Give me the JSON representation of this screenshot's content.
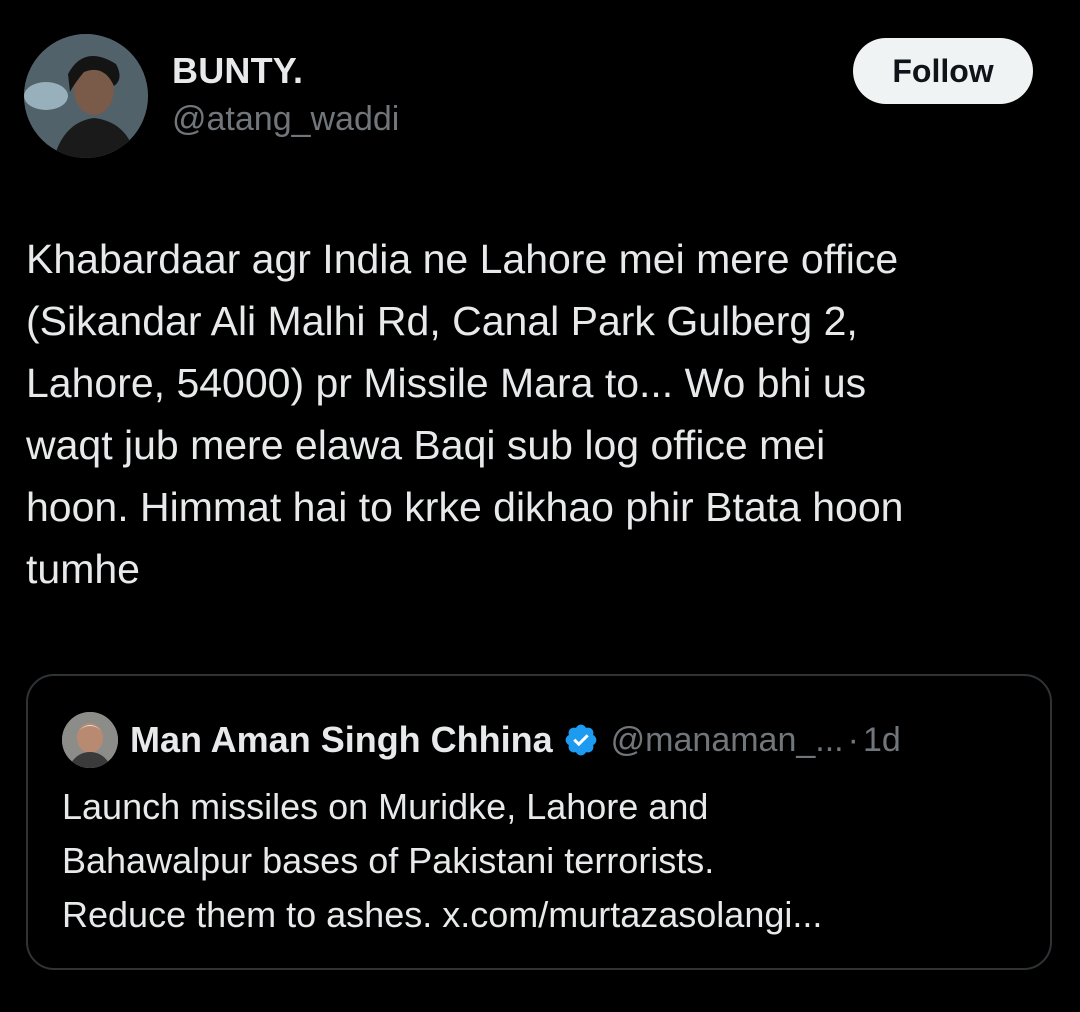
{
  "author": {
    "display_name": "BUNTY.",
    "handle": "@atang_waddi",
    "avatar_icon": "user-avatar-photo"
  },
  "follow_button": {
    "label": "Follow"
  },
  "tweet": {
    "text": "Khabardaar agr India ne Lahore mei mere office\n(Sikandar Ali Malhi Rd, Canal Park Gulberg 2,\nLahore, 54000) pr Missile Mara to... Wo bhi us\nwaqt jub mere elawa Baqi sub log office mei\nhoon. Himmat hai to krke dikhao phir Btata hoon\ntumhe"
  },
  "quoted_tweet": {
    "display_name": "Man Aman Singh Chhina",
    "verified_icon": "verified-badge-icon",
    "handle": "@manaman_...",
    "separator": "·",
    "time": "1d",
    "text": "Launch missiles on Muridke, Lahore and\nBahawalpur bases of Pakistani terrorists.\nReduce them to ashes. x.com/murtazasolangi..."
  },
  "colors": {
    "background": "#000000",
    "text_primary": "#e7e9ea",
    "text_secondary": "#71767b",
    "border": "#2f3336",
    "verified_blue": "#1d9bf0",
    "follow_bg": "#eff3f4"
  }
}
